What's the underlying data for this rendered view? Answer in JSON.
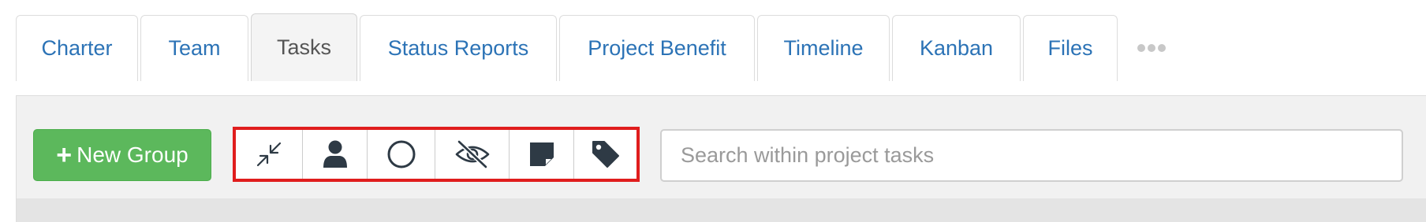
{
  "tabs": [
    {
      "label": "Charter",
      "active": false
    },
    {
      "label": "Team",
      "active": false
    },
    {
      "label": "Tasks",
      "active": true
    },
    {
      "label": "Status Reports",
      "active": false
    },
    {
      "label": "Project Benefit",
      "active": false
    },
    {
      "label": "Timeline",
      "active": false
    },
    {
      "label": "Kanban",
      "active": false
    },
    {
      "label": "Files",
      "active": false
    }
  ],
  "toolbar": {
    "new_group_label": "New Group",
    "icons": [
      "collapse-arrows-icon",
      "user-icon",
      "circle-icon",
      "eye-slash-icon",
      "sticky-note-icon",
      "tag-icon"
    ],
    "search_placeholder": "Search within project tasks",
    "search_value": ""
  },
  "colors": {
    "link": "#2c73b6",
    "success": "#5cb85c",
    "highlight": "#e01d1d",
    "icon": "#2e3a45"
  }
}
